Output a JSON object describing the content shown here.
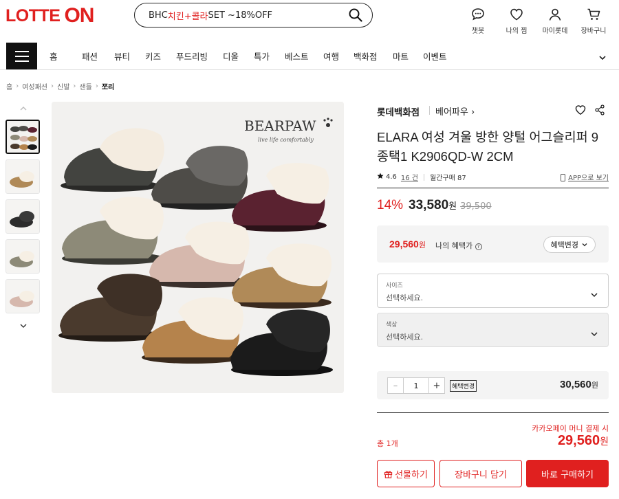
{
  "header": {
    "logo_part1": "LOTTE",
    "logo_part2": "ON",
    "search": {
      "prefix": "BHC ",
      "highlight": "치킨+콜라",
      "suffix": "SET ~18%OFF"
    },
    "utils": [
      {
        "label": "챗봇",
        "icon": "chat-icon"
      },
      {
        "label": "나의 찜",
        "icon": "heart-icon"
      },
      {
        "label": "마이롯데",
        "icon": "person-icon"
      },
      {
        "label": "장바구니",
        "icon": "cart-icon"
      }
    ]
  },
  "nav": {
    "items": [
      "홈",
      "패션",
      "뷰티",
      "키즈",
      "푸드리빙",
      "디올",
      "특가",
      "베스트",
      "여행",
      "백화점",
      "마트",
      "이벤트"
    ]
  },
  "breadcrumb": [
    "홈",
    "여성패션",
    "신발",
    "샌들",
    "쪼리"
  ],
  "image": {
    "brand_mark": "BEARPAW",
    "tagline": "live life comfortably"
  },
  "product": {
    "seller": "롯데백화점",
    "brand": "베어파우 ›",
    "title": "ELARA 여성 겨울 방한 양털 어그슬리퍼 9종택1 K2906QD-W 2CM",
    "rating": "4.6",
    "review_count": "16 건",
    "monthly": "월간구매 87",
    "app_link": "APP으로 보기",
    "discount": "14%",
    "price": "33,580",
    "price_unit": "원",
    "original_price": "39,500",
    "benefit_price": "29,560",
    "benefit_unit": "원",
    "benefit_label": "나의 혜택가",
    "benefit_button": "혜택변경",
    "options": [
      {
        "label": "사이즈",
        "value": "선택하세요."
      },
      {
        "label": "색상",
        "value": "선택하세요."
      }
    ],
    "quantity": "1",
    "qty_tag": "혜택변경",
    "qty_price": "30,560",
    "qty_unit": "원",
    "kakao_text": "카카오페이 머니 결제 시",
    "total_label": "총 1개",
    "total_price": "29,560",
    "total_unit": "원",
    "gift_button": "선물하기",
    "cart_button": "장바구니 담기",
    "buy_button": "바로 구매하기"
  },
  "colors": {
    "accent": "#e0201f"
  }
}
